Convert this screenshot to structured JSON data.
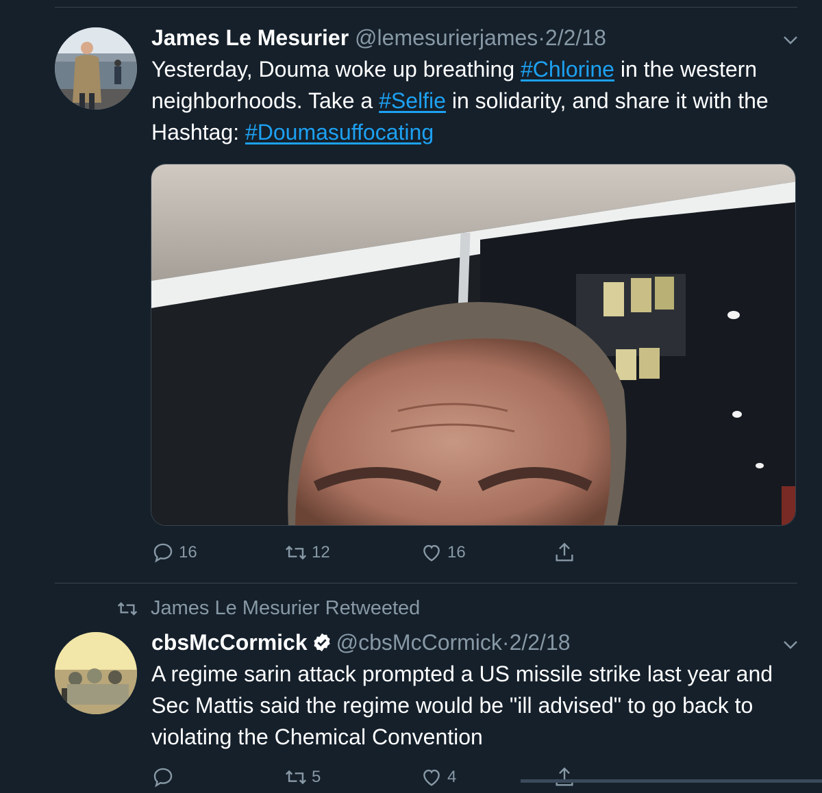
{
  "tweet1": {
    "author_name": "James Le Mesurier",
    "handle": "@lemesurierjames",
    "separator": "·",
    "date": "2/2/18",
    "text_1": "Yesterday, Douma woke up breathing ",
    "hashtag_1": "#Chlorine",
    "text_2": " in the western neighborhoods. Take a ",
    "hashtag_2": "#Selfie",
    "text_3": " in solidarity, and share it with the Hashtag: ",
    "hashtag_3": "#Doumasuffocating",
    "replies": "16",
    "retweets": "12",
    "likes": "16"
  },
  "retweet_label": "James Le Mesurier Retweeted",
  "tweet2": {
    "author_name": "cbsMcCormick",
    "handle": "@cbsMcCormick",
    "separator": "·",
    "date": "2/2/18",
    "text": "A regime sarin attack prompted a US missile strike last year and Sec Mattis said the regime would be \"ill advised\" to go back to violating the Chemical Convention",
    "replies": "",
    "retweets": "5",
    "likes": "4"
  },
  "icons": [
    "chevron-down-icon",
    "reply-icon",
    "retweet-icon",
    "like-icon",
    "share-icon",
    "verified-badge-icon"
  ],
  "colors": {
    "background": "#15202b",
    "link": "#1da1f2",
    "secondary_text": "#8899a6",
    "divider": "#38444d"
  }
}
